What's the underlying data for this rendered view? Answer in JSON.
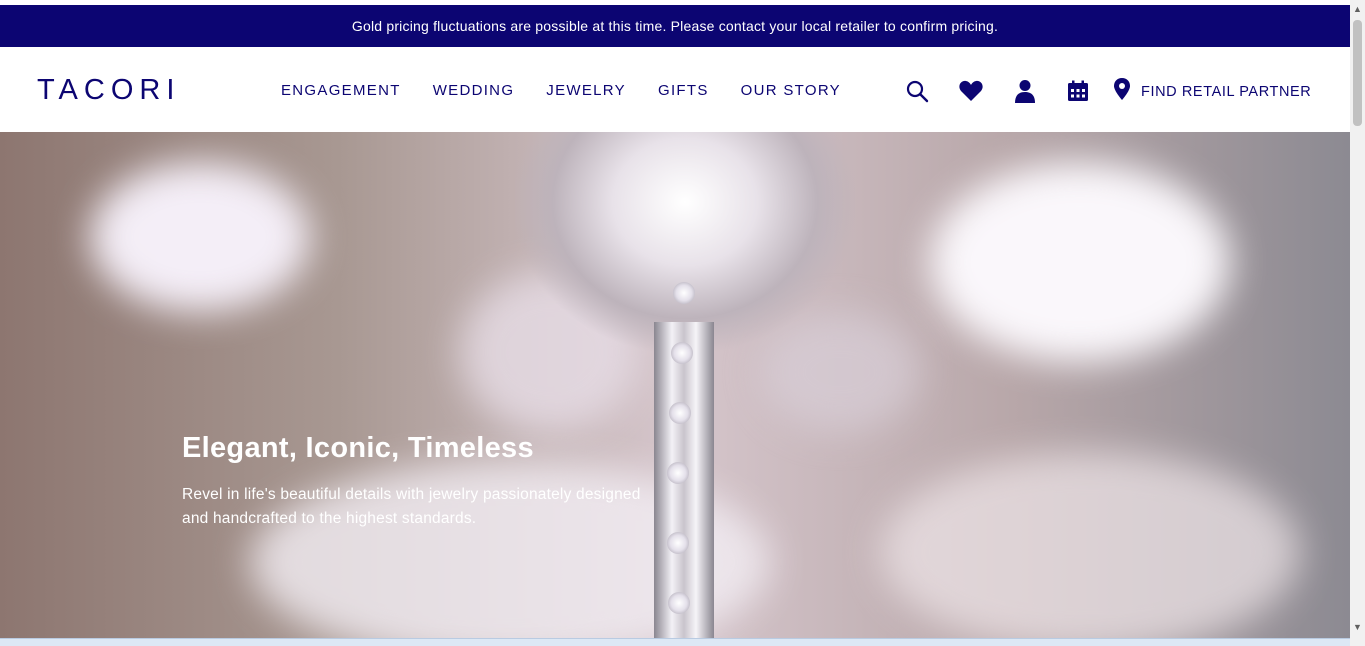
{
  "announcement": "Gold pricing fluctuations are possible at this time. Please contact your local retailer to confirm pricing.",
  "header": {
    "logo": "TACORI",
    "nav": [
      "ENGAGEMENT",
      "WEDDING",
      "JEWELRY",
      "GIFTS",
      "OUR STORY"
    ],
    "icons": [
      "search-icon",
      "heart-icon",
      "user-icon",
      "calendar-icon"
    ],
    "find_retail_partner": "FIND RETAIL PARTNER"
  },
  "hero": {
    "title": "Elegant, Iconic, Timeless",
    "subtitle": "Revel in life's beautiful details with jewelry passionately designed and handcrafted to the highest standards."
  },
  "colors": {
    "brand_navy": "#0c0572",
    "white": "#ffffff"
  }
}
